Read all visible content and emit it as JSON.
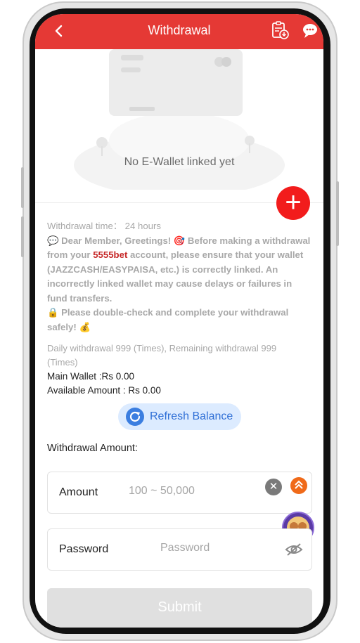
{
  "header": {
    "title": "Withdrawal",
    "back_icon": "chevron-left-icon",
    "history_icon": "clipboard-download-icon",
    "support_icon": "chat-support-icon"
  },
  "wallet": {
    "empty_message": "No E-Wallet linked yet",
    "add_icon": "plus-icon"
  },
  "info": {
    "withdrawal_time_label": "Withdrawal time：",
    "withdrawal_time_value": "24 hours",
    "notice_intro": "💬 Dear Member, Greetings! 🎯 Before making a withdrawal from your ",
    "brand": "5555bet",
    "notice_body": " account, please ensure that your wallet (JAZZCASH/EASYPAISA, etc.) is correctly linked. An incorrectly linked wallet may cause delays or failures in fund transfers.",
    "notice_check": "🔒 Please double-check and complete your withdrawal safely! 💰"
  },
  "limits": {
    "text": "Daily withdrawal 999 (Times), Remaining withdrawal 999 (Times)"
  },
  "balances": {
    "main_wallet": "Main Wallet :Rs 0.00",
    "available": "Available Amount : Rs 0.00"
  },
  "refresh": {
    "label": "Refresh Balance",
    "icon": "refresh-icon"
  },
  "form": {
    "amount_title": "Withdrawal Amount:",
    "amount_label": "Amount",
    "amount_placeholder": "100 ~ 50,000",
    "amount_value": "",
    "password_label": "Password",
    "password_placeholder": "Password",
    "password_value": "",
    "submit_label": "Submit"
  },
  "colors": {
    "header": "#e53935",
    "accent_red": "#f21c1c",
    "brand_text": "#c62828",
    "refresh_bg": "#dcebff",
    "refresh_text": "#2f6fd6",
    "submit_disabled": "#e0e0e0"
  }
}
